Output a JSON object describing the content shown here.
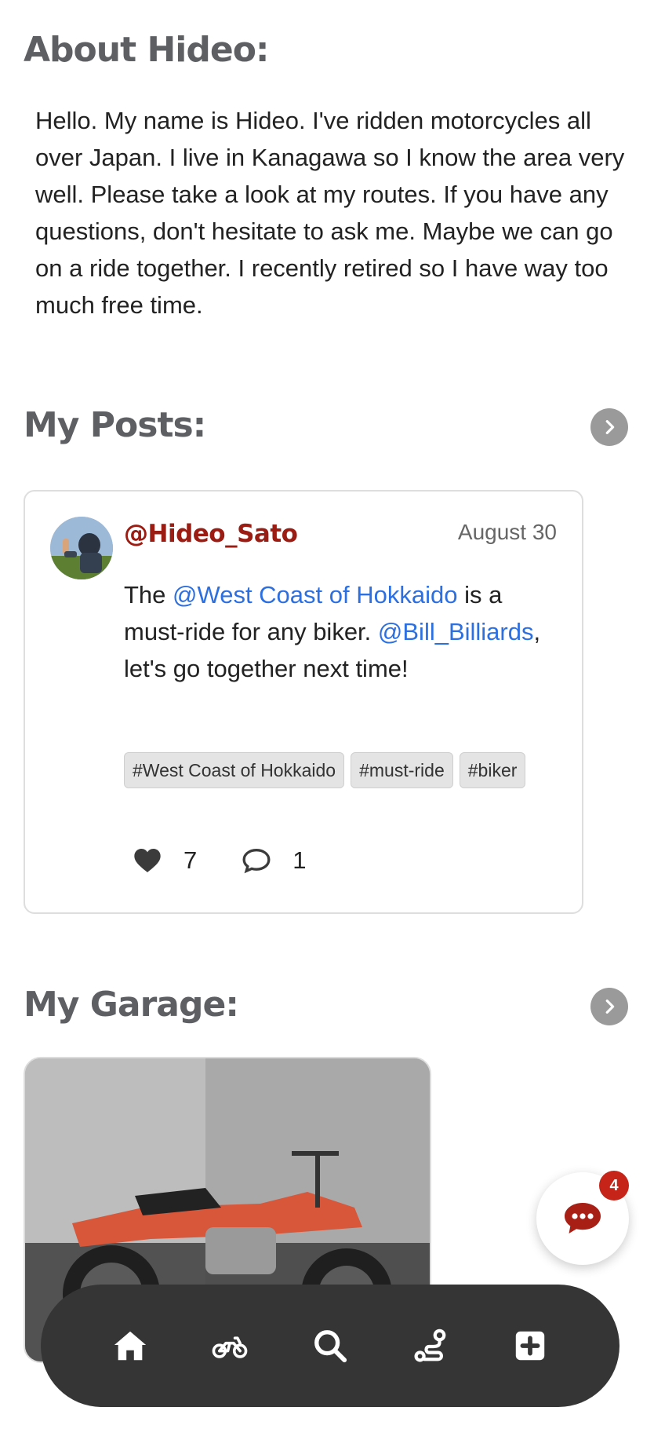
{
  "about": {
    "title": "About Hideo:",
    "text": "Hello. My name is Hideo. I've ridden motorcycles all over Japan. I live in Kanagawa so I know the area very well. Please take a look at my routes. If you have any questions, don't hesitate to ask me. Maybe we can go on a ride together. I recently retired so I have way too much free time."
  },
  "posts": {
    "title": "My Posts:",
    "more_icon": "chevron-right-icon",
    "post": {
      "username": "@Hideo_Sato",
      "date": "August 30",
      "body_1": "The ",
      "mention_1": "@West Coast of Hokkaido",
      "body_2": " is a must-ride for any biker. ",
      "mention_2": "@Bill_Billiards",
      "body_3": ", let's go together next time!",
      "tags": [
        "#West Coast of Hokkaido",
        "#must-ride",
        "#biker"
      ],
      "likes": "7",
      "comments": "1"
    }
  },
  "garage": {
    "title": "My Garage:",
    "more_icon": "chevron-right-icon"
  },
  "chat": {
    "badge": "4",
    "icon": "chat-bubble-icon"
  },
  "nav": {
    "items": [
      "home-icon",
      "motorcycle-icon",
      "search-icon",
      "route-icon",
      "add-post-icon"
    ]
  },
  "colors": {
    "username": "#9a1c12",
    "mention": "#2c6fe0",
    "badge": "#c62418",
    "nav_bg": "#353535"
  }
}
